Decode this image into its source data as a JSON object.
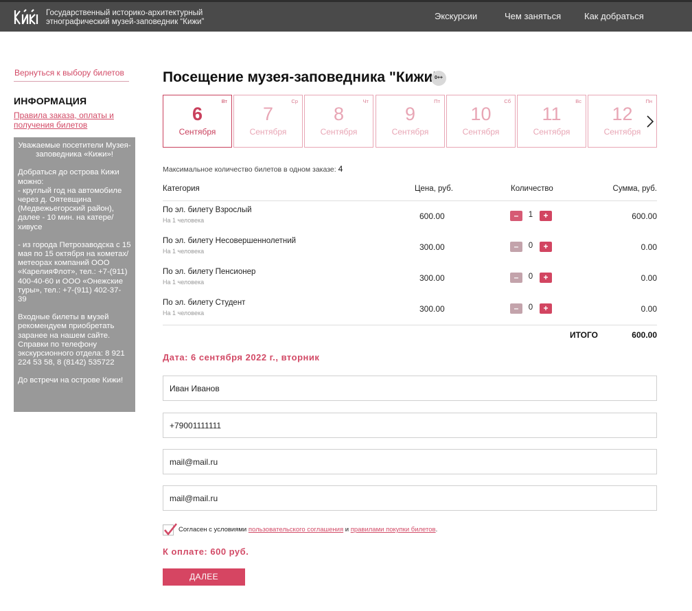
{
  "header": {
    "title_line1": "Государственный историко-архитектурный",
    "title_line2": "этнографический музей-заповедник “Кижи”",
    "nav": [
      "Экскурсии",
      "Чем заняться",
      "Как добраться"
    ]
  },
  "sidebar": {
    "back_link": "Вернуться к выбору билетов",
    "info_title": "ИНФОРМАЦИЯ",
    "rules_link": "Правила заказа, оплаты и получения билетов",
    "info_heading": "Уважаемые посетители Музея-заповедника «Кижи»!",
    "info_p1": "Добраться до острова Кижи можно:\n- круглый год на автомобиле через д. Оятевщина (Медвежьегорский район), далее - 10 мин. на катере/хивусе",
    "info_p2": "- из города Петрозаводска с 15 мая по 15 октября на кометах/метеорах компаний ООО «КарелияФлот», тел.: +7-(911) 400-40-60 и ООО «Онежские туры», тел.: +7-(911) 402-37- 39",
    "info_p3": "Входные билеты в музей рекомендуем приобретать заранее на нашем сайте. Справки по телефону экскурсионного отдела: 8 921 224 53 58, 8 (8142) 535722",
    "info_p4": "До встречи на острове Кижи!"
  },
  "main": {
    "title": "Посещение музея-заповедника \"Кижи\"",
    "age_badge": "0++",
    "dates": [
      {
        "day": "6",
        "dow": "Вт",
        "month": "Сентября",
        "active": true
      },
      {
        "day": "7",
        "dow": "Ср",
        "month": "Сентября",
        "active": false
      },
      {
        "day": "8",
        "dow": "Чт",
        "month": "Сентября",
        "active": false
      },
      {
        "day": "9",
        "dow": "Пт",
        "month": "Сентября",
        "active": false
      },
      {
        "day": "10",
        "dow": "Сб",
        "month": "Сентября",
        "active": false
      },
      {
        "day": "11",
        "dow": "Вс",
        "month": "Сентября",
        "active": false
      },
      {
        "day": "12",
        "dow": "Пн",
        "month": "Сентября",
        "active": false
      }
    ],
    "max_label": "Максимальное количество билетов в одном заказе:",
    "max_value": "4",
    "table": {
      "headers": {
        "category": "Категория",
        "price": "Цена, руб.",
        "qty": "Количество",
        "sum": "Сумма, руб."
      },
      "rows": [
        {
          "name": "По эл. билету Взрослый",
          "sub": "На 1 человека",
          "price": "600.00",
          "qty": "1",
          "sum": "600.00"
        },
        {
          "name": "По эл. билету Несовершеннолетний",
          "sub": "На 1 человека",
          "price": "300.00",
          "qty": "0",
          "sum": "0.00"
        },
        {
          "name": "По эл. билету Пенсионер",
          "sub": "На 1 человека",
          "price": "300.00",
          "qty": "0",
          "sum": "0.00"
        },
        {
          "name": "По эл. билету Студент",
          "sub": "На 1 человека",
          "price": "300.00",
          "qty": "0",
          "sum": "0.00"
        }
      ],
      "minus": "–",
      "plus": "+",
      "total_label": "ИТОГО",
      "total_value": "600.00"
    },
    "date_heading": "Дата: 6 сентября 2022 г., вторник",
    "form": {
      "name": "Иван Иванов",
      "phone": "+79001111111",
      "email": "mail@mail.ru",
      "email_confirm": "mail@mail.ru"
    },
    "agreement": {
      "checked": true,
      "text1": "Согласен с условиями",
      "link1": "пользовательского соглашения",
      "text2": "и",
      "link2": "правилами покупки билетов",
      "text3": "."
    },
    "pay_label": "К оплате: 600 руб.",
    "next_button": "ДАЛЕЕ"
  },
  "colors": {
    "accent": "#d24a66",
    "header_bg": "#4a4a4a",
    "info_bg": "#999999"
  }
}
